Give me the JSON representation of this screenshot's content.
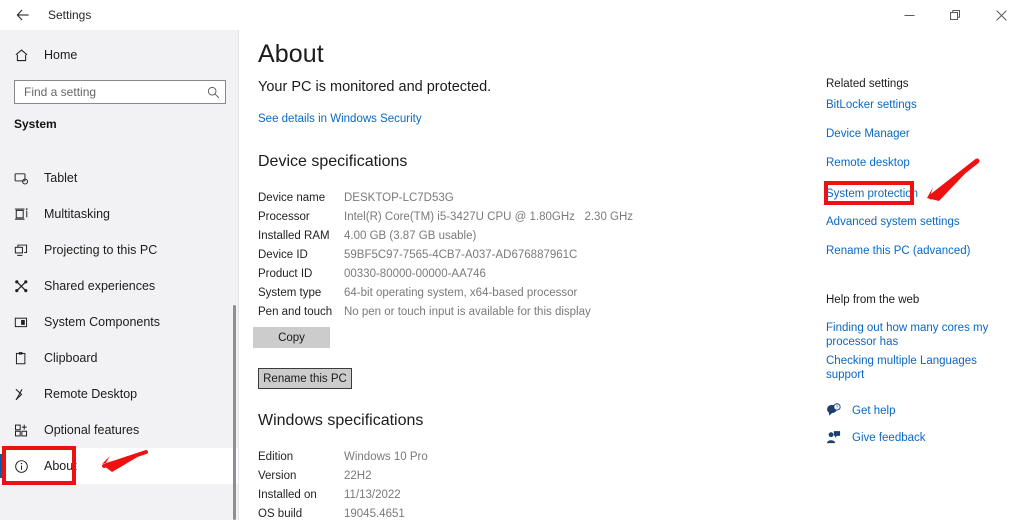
{
  "window": {
    "title": "Settings",
    "back_icon": "back-arrow-icon",
    "controls": [
      {
        "name": "minimize",
        "icon": "minimize-icon"
      },
      {
        "name": "restore",
        "icon": "restore-icon"
      },
      {
        "name": "close",
        "icon": "close-icon"
      }
    ]
  },
  "sidebar": {
    "home": {
      "label": "Home",
      "icon": "home-icon"
    },
    "search": {
      "placeholder": "Find a setting",
      "value": "",
      "icon": "search-icon"
    },
    "group_title": "System",
    "items": [
      {
        "label": "Tablet",
        "icon": "tablet-icon",
        "selected": false
      },
      {
        "label": "Multitasking",
        "icon": "multitasking-icon",
        "selected": false
      },
      {
        "label": "Projecting to this PC",
        "icon": "projecting-icon",
        "selected": false
      },
      {
        "label": "Shared experiences",
        "icon": "shared-experiences-icon",
        "selected": false
      },
      {
        "label": "System Components",
        "icon": "system-components-icon",
        "selected": false
      },
      {
        "label": "Clipboard",
        "icon": "clipboard-icon",
        "selected": false
      },
      {
        "label": "Remote Desktop",
        "icon": "remote-desktop-icon",
        "selected": false
      },
      {
        "label": "Optional features",
        "icon": "optional-features-icon",
        "selected": false
      },
      {
        "label": "About",
        "icon": "about-info-icon",
        "selected": true
      }
    ]
  },
  "main": {
    "page_title": "About",
    "pc_status": "Your PC is monitored and protected.",
    "security_link": "See details in Windows Security",
    "device_specifications": {
      "heading": "Device specifications",
      "rows": [
        {
          "key": "Device name",
          "value": "DESKTOP-LC7D53G"
        },
        {
          "key": "Processor",
          "value": "Intel(R) Core(TM) i5-3427U CPU @ 1.80GHz   2.30 GHz"
        },
        {
          "key": "Installed RAM",
          "value": "4.00 GB (3.87 GB usable)"
        },
        {
          "key": "Device ID",
          "value": "59BF5C97-7565-4CB7-A037-AD676887961C"
        },
        {
          "key": "Product ID",
          "value": "00330-80000-00000-AA746"
        },
        {
          "key": "System type",
          "value": "64-bit operating system, x64-based processor"
        },
        {
          "key": "Pen and touch",
          "value": "No pen or touch input is available for this display"
        }
      ],
      "copy_button": "Copy",
      "rename_button": "Rename this PC"
    },
    "windows_specifications": {
      "heading": "Windows specifications",
      "rows": [
        {
          "key": "Edition",
          "value": "Windows 10 Pro"
        },
        {
          "key": "Version",
          "value": "22H2"
        },
        {
          "key": "Installed on",
          "value": "11/13/2022"
        },
        {
          "key": "OS build",
          "value": "19045.4651"
        }
      ]
    }
  },
  "rail": {
    "related_settings": {
      "heading": "Related settings",
      "links": [
        "BitLocker settings",
        "Device Manager",
        "Remote desktop",
        "System protection",
        "Advanced system settings",
        "Rename this PC (advanced)"
      ]
    },
    "help_from_web": {
      "heading": "Help from the web",
      "links": [
        "Finding out how many cores my processor has",
        "Checking multiple Languages support"
      ],
      "actions": [
        {
          "label": "Get help",
          "icon": "get-help-icon"
        },
        {
          "label": "Give feedback",
          "icon": "give-feedback-icon"
        }
      ]
    }
  },
  "annotations": {
    "highlight_color": "#ee1111",
    "boxes": [
      {
        "target": "About",
        "shape": "rectangle"
      },
      {
        "target": "System protection",
        "shape": "rectangle"
      }
    ],
    "arrows": [
      {
        "target": "About",
        "direction": "points-left"
      },
      {
        "target": "System protection",
        "direction": "points-down-left"
      }
    ]
  },
  "colors": {
    "link": "#0a68c4",
    "accent": "#0b5da8",
    "sidebar_bg": "#f2f2f4",
    "button_bg": "#cccccc"
  }
}
